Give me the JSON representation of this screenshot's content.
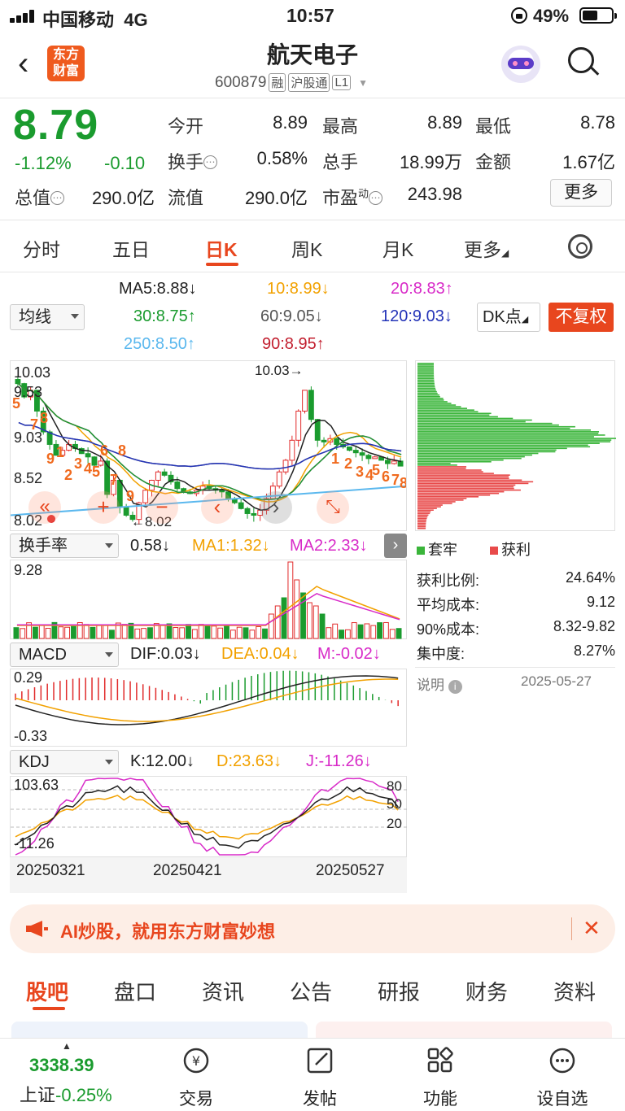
{
  "status": {
    "carrier": "中国移动",
    "network": "4G",
    "time": "10:57",
    "battery": "49%"
  },
  "header": {
    "logo": [
      "东方",
      "财富"
    ],
    "title": "航天电子",
    "code": "600879",
    "tags": [
      "融",
      "沪股通",
      "L1"
    ]
  },
  "quote": {
    "price": "8.79",
    "change_pct": "-1.12%",
    "change": "-0.10",
    "open_label": "今开",
    "open": "8.89",
    "high_label": "最高",
    "high": "8.89",
    "low_label": "最低",
    "low": "8.78",
    "turnover_label": "换手",
    "turnover": "0.58%",
    "volume_label": "总手",
    "volume": "18.99万",
    "amount_label": "金额",
    "amount": "1.67亿",
    "mktcap_label": "总值",
    "mktcap": "290.0亿",
    "float_label": "流值",
    "float": "290.0亿",
    "pe_label": "市盈",
    "pe_sup": "动",
    "pe": "243.98",
    "more": "更多"
  },
  "tabs": [
    "分时",
    "五日",
    "日K",
    "周K",
    "月K",
    "更多"
  ],
  "ma": {
    "ma5": "MA5:8.88",
    "ma10": "10:8.99",
    "ma20": "20:8.83",
    "ma30": "30:8.75",
    "ma60": "60:9.05",
    "ma120": "120:9.03",
    "ma250": "250:8.50",
    "ma90": "90:8.95",
    "selector": "均线",
    "dk": "DK点",
    "fuquan": "不复权"
  },
  "kline": {
    "y_labels": [
      "10.03",
      "9.53",
      "9.03",
      "8.52",
      "8.02"
    ],
    "high_note": "10.03",
    "low_note": "8.02",
    "signals_left": [
      "5",
      "7",
      "8",
      "9",
      "1",
      "2",
      "3",
      "4",
      "5",
      "6",
      "8",
      "7",
      "9"
    ],
    "signals_right": [
      "1",
      "2",
      "3",
      "4",
      "5",
      "6",
      "7",
      "8"
    ],
    "closes": [
      9.78,
      9.62,
      9.7,
      9.45,
      9.2,
      9.05,
      8.92,
      8.98,
      9.05,
      9.0,
      8.94,
      8.9,
      8.8,
      8.85,
      8.45,
      8.62,
      8.3,
      8.2,
      8.15,
      8.35,
      8.5,
      8.62,
      8.72,
      8.68,
      8.6,
      8.52,
      8.48,
      8.46,
      8.5,
      8.55,
      8.52,
      8.5,
      8.48,
      8.4,
      8.35,
      8.28,
      8.22,
      8.2,
      8.26,
      8.4,
      8.55,
      8.72,
      8.86,
      9.1,
      9.45,
      9.7,
      9.35,
      9.1,
      9.08,
      9.12,
      9.05,
      9.02,
      8.98,
      8.95,
      8.92,
      8.88,
      8.9,
      8.86,
      8.82,
      8.85,
      8.79
    ]
  },
  "chips": {
    "legend_trapped": "套牢",
    "legend_profit": "获利",
    "rows": [
      {
        "label": "获利比例:",
        "value": "24.64%"
      },
      {
        "label": "平均成本:",
        "value": "9.12"
      },
      {
        "label": "90%成本:",
        "value": "8.32-9.82"
      },
      {
        "label": "集中度:",
        "value": "8.27%"
      }
    ],
    "note_label": "说明",
    "date": "2025-05-27"
  },
  "turnover": {
    "selector": "换手率",
    "value": "0.58",
    "ma1": "MA1:1.32",
    "ma2": "MA2:2.33",
    "max": "9.28"
  },
  "macd": {
    "selector": "MACD",
    "dif": "DIF:0.03",
    "dea": "DEA:0.04",
    "m": "M:-0.02",
    "top": "0.29",
    "bottom": "-0.33"
  },
  "kdj": {
    "selector": "KDJ",
    "k": "K:12.00",
    "d": "D:23.63",
    "j": "J:-11.26",
    "top": "103.63",
    "bottom": "-11.26",
    "levels": [
      "80",
      "50",
      "20"
    ]
  },
  "x_dates": [
    "20250321",
    "20250421",
    "20250527"
  ],
  "banner": {
    "text": "AI炒股，就用东方财富妙想"
  },
  "bottom_tabs": [
    "股吧",
    "盘口",
    "资讯",
    "公告",
    "研报",
    "财务",
    "资料"
  ],
  "nav": {
    "index_value": "3338.39",
    "index_label": "上证",
    "index_change": "-0.25%",
    "items": [
      "交易",
      "发帖",
      "功能",
      "设自选"
    ]
  }
}
